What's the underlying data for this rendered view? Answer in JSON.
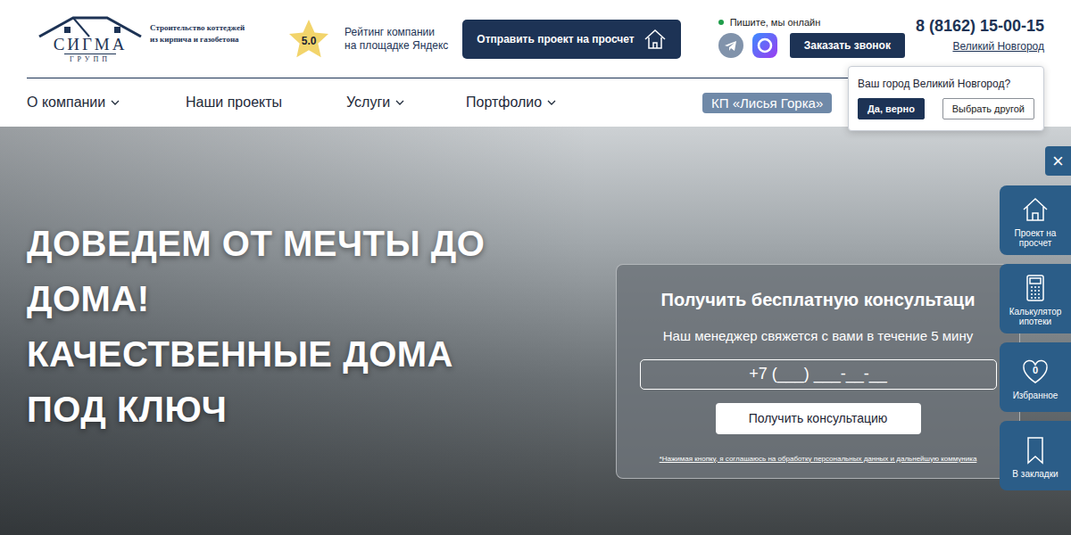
{
  "logo": {
    "name": "СИГМА",
    "sub": "ГРУПП",
    "tagline": [
      "Строительство коттеджей",
      "из кирпича и газобетона"
    ]
  },
  "rating": {
    "score": "5.0",
    "lines": [
      "Рейтинг компании",
      "на площадке Яндекс"
    ]
  },
  "header_actions": {
    "send_project": "Отправить проект на просчет",
    "online_status": "Пишите, мы онлайн",
    "online": true,
    "callback": "Заказать звонок"
  },
  "contacts": {
    "phone": "8 (8162) 15-00-15",
    "city": "Великий Новгород"
  },
  "nav": [
    {
      "label": "О компании",
      "dropdown": true,
      "highlighted": false
    },
    {
      "label": "Наши проекты",
      "dropdown": false,
      "highlighted": false
    },
    {
      "label": "Услуги",
      "dropdown": true,
      "highlighted": false
    },
    {
      "label": "Портфолио",
      "dropdown": true,
      "highlighted": false
    },
    {
      "label": "КП «Лисья Горка»",
      "dropdown": false,
      "highlighted": true
    }
  ],
  "city_prompt": {
    "question": "Ваш город Великий Новгород?",
    "confirm": "Да, верно",
    "other": "Выбрать другой"
  },
  "hero": {
    "title_lines": [
      "ДОВЕДЕМ ОТ МЕЧТЫ ДО",
      "ДОМА!",
      "КАЧЕСТВЕННЫЕ ДОМА",
      "ПОД КЛЮЧ"
    ]
  },
  "consultation_form": {
    "title": "Получить бесплатную консультаци",
    "subtitle": "Наш менеджер свяжется с вами в течение 5 мину",
    "phone_placeholder": "+7 (___) ___-__-__",
    "button": "Получить консультацию",
    "disclaimer": "*Нажимая кнопку, я соглашаюсь на обработку персональных данных и дальнейшую коммуника"
  },
  "side_panel": {
    "close": "×",
    "items": [
      {
        "kind": "project",
        "label": [
          "Проект на",
          "просчет"
        ]
      },
      {
        "kind": "calculator",
        "label": [
          "Калькулятор",
          "ипотеки"
        ]
      },
      {
        "kind": "favorites",
        "label": [
          "Избранное"
        ],
        "badge": "0"
      },
      {
        "kind": "bookmark",
        "label": [
          "В закладки"
        ]
      }
    ]
  }
}
